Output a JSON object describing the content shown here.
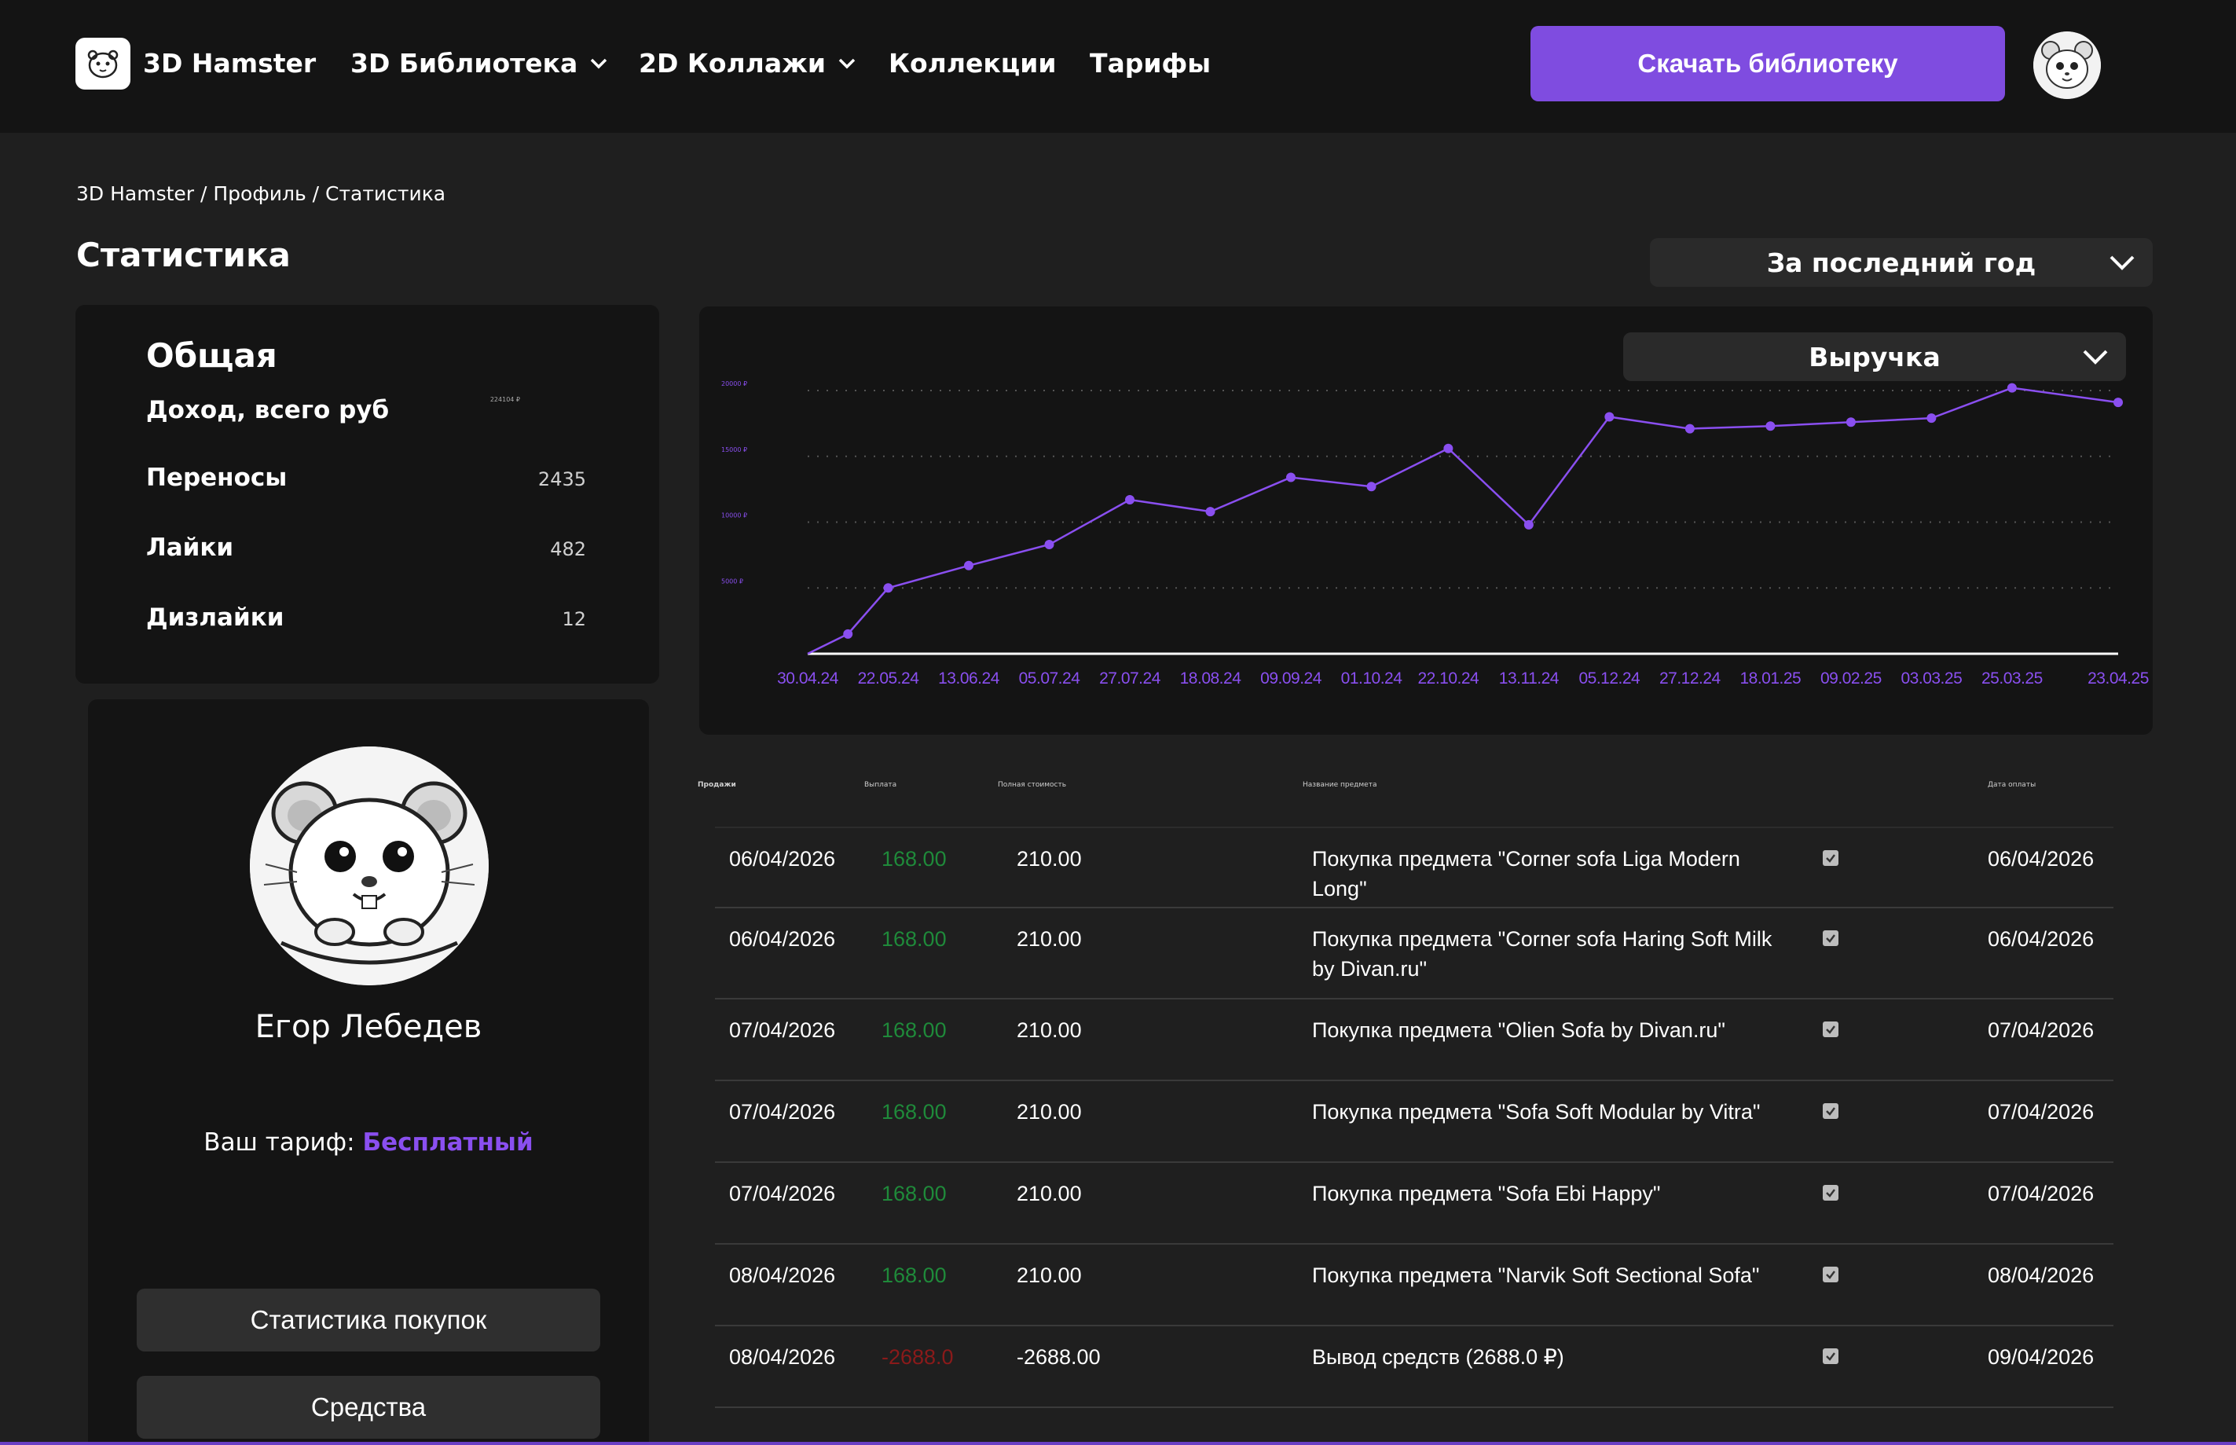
{
  "header": {
    "logo_text": "3D Hamster",
    "nav": [
      {
        "label": "3D Библиотека",
        "has_dropdown": true
      },
      {
        "label": "2D Коллажи",
        "has_dropdown": true
      },
      {
        "label": "Коллекции",
        "has_dropdown": false
      },
      {
        "label": "Тарифы",
        "has_dropdown": false
      }
    ],
    "download_button": "Скачать библиотеку"
  },
  "breadcrumb": "3D Hamster / Профиль / Статистика",
  "page_title": "Статистика",
  "period_select": "За последний год",
  "general": {
    "title": "Общая",
    "rows": [
      {
        "label": "Доход, всего руб",
        "value": "224104 ₽"
      },
      {
        "label": "Переносы",
        "value": "2435"
      },
      {
        "label": "Лайки",
        "value": "482"
      },
      {
        "label": "Дизлайки",
        "value": "12"
      }
    ]
  },
  "profile": {
    "name": "Егор Лебедев",
    "tariff_label": "Ваш тариф:",
    "tariff_value": "Бесплатный",
    "buttons": [
      "Статистика покупок",
      "Средства"
    ]
  },
  "metric_select": "Выручка",
  "colors": {
    "accent": "#7f4ce0",
    "line": "#8a4ff0",
    "positive": "#1f8a3a",
    "negative": "#8a1a1a"
  },
  "chart_data": {
    "type": "line",
    "x": [
      "30.04.24",
      "22.05.24",
      "13.06.24",
      "05.07.24",
      "27.07.24",
      "18.08.24",
      "09.09.24",
      "01.10.24",
      "22.10.24",
      "13.11.24",
      "05.12.24",
      "27.12.24",
      "18.01.25",
      "09.02.25",
      "03.03.25",
      "25.03.25",
      "23.04.25"
    ],
    "y_ticks": [
      "20000 ₽",
      "15000 ₽",
      "10000 ₽",
      "5000 ₽"
    ],
    "y_tick_values": [
      20000,
      15000,
      10000,
      5000
    ],
    "ylim": [
      0,
      20000
    ],
    "grid": true,
    "series": [
      {
        "x": [
          "30.04.24",
          "11.05.24",
          "22.05.24",
          "13.06.24",
          "05.07.24",
          "27.07.24",
          "18.08.24",
          "09.09.24",
          "01.10.24",
          "22.10.24",
          "13.11.24",
          "05.12.24",
          "27.12.24",
          "18.01.25",
          "09.02.25",
          "03.03.25",
          "25.03.25",
          "23.04.25"
        ],
        "values": [
          0,
          1500,
          5000,
          6700,
          8300,
          11700,
          10800,
          13400,
          12700,
          15600,
          9800,
          18000,
          17100,
          17300,
          17600,
          17900,
          20200,
          19100
        ]
      }
    ]
  },
  "table": {
    "headers": [
      "Продажи",
      "Выплата",
      "Полная стоимость",
      "Название предмета",
      "Дата оплаты"
    ],
    "rows": [
      {
        "date": "06/04/2026",
        "payout": "168.00",
        "full": "210.00",
        "name": "Покупка предмета \"Corner sofa Liga Modern Long\"",
        "paid": "06/04/2026",
        "neg": false
      },
      {
        "date": "06/04/2026",
        "payout": "168.00",
        "full": "210.00",
        "name": "Покупка предмета \"Corner sofa Haring Soft Milk by Divan.ru\"",
        "paid": "06/04/2026",
        "neg": false
      },
      {
        "date": "07/04/2026",
        "payout": "168.00",
        "full": "210.00",
        "name": "Покупка предмета \"Olien Sofa by Divan.ru\"",
        "paid": "07/04/2026",
        "neg": false
      },
      {
        "date": "07/04/2026",
        "payout": "168.00",
        "full": "210.00",
        "name": "Покупка предмета \"Sofa Soft Modular by Vitra\"",
        "paid": "07/04/2026",
        "neg": false
      },
      {
        "date": "07/04/2026",
        "payout": "168.00",
        "full": "210.00",
        "name": "Покупка предмета \"Sofa Ebi Happy\"",
        "paid": "07/04/2026",
        "neg": false
      },
      {
        "date": "08/04/2026",
        "payout": "168.00",
        "full": "210.00",
        "name": "Покупка предмета \"Narvik Soft Sectional Sofa\"",
        "paid": "08/04/2026",
        "neg": false
      },
      {
        "date": "08/04/2026",
        "payout": "-2688.0",
        "full": "-2688.00",
        "name": "Вывод средств (2688.0 ₽)",
        "paid": "09/04/2026",
        "neg": true
      }
    ]
  }
}
